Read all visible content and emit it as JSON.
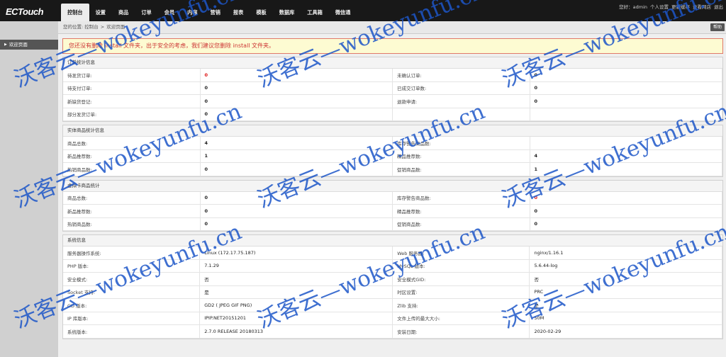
{
  "app": {
    "logo": "ECTouch"
  },
  "nav": [
    "控制台",
    "设置",
    "商品",
    "订单",
    "会员",
    "内容",
    "营销",
    "报表",
    "模板",
    "数据库",
    "工具箱",
    "微信通"
  ],
  "top_links": [
    "您好：admin",
    "个人设置",
    "更新缓存",
    "查看网店",
    "退出"
  ],
  "sidebar": {
    "items": [
      {
        "label": "欢迎页面"
      }
    ]
  },
  "breadcrumb": {
    "prefix": "您的位置:",
    "path": [
      "控制台",
      "欢迎页面"
    ],
    "help": "帮助"
  },
  "warning": "您还没有删除 install 文件夹，出于安全的考虑，我们建议您删除 install 文件夹。",
  "panels": [
    {
      "title": "订单统计信息",
      "rows": [
        [
          [
            "待发货订单:",
            "0",
            "red"
          ],
          [
            "未确认订单:",
            "0",
            ""
          ]
        ],
        [
          [
            "待支付订单:",
            "0",
            ""
          ],
          [
            "已成交订单数:",
            "0",
            ""
          ]
        ],
        [
          [
            "新缺货登记:",
            "0",
            ""
          ],
          [
            "退款申请:",
            "0",
            ""
          ]
        ],
        [
          [
            "部分发货订单:",
            "0",
            ""
          ],
          [
            "",
            "",
            " "
          ]
        ]
      ]
    },
    {
      "title": "实体商品统计信息",
      "rows": [
        [
          [
            "商品总数:",
            "4",
            ""
          ],
          [
            "库存警告商品数:",
            "",
            ""
          ]
        ],
        [
          [
            "新品推荐数:",
            "1",
            ""
          ],
          [
            "精品推荐数:",
            "4",
            ""
          ]
        ],
        [
          [
            "热销商品数:",
            "0",
            ""
          ],
          [
            "促销商品数:",
            "1",
            ""
          ]
        ]
      ]
    },
    {
      "title": "虚拟卡商品统计",
      "rows": [
        [
          [
            "商品总数:",
            "0",
            ""
          ],
          [
            "库存警告商品数:",
            "0",
            "red"
          ]
        ],
        [
          [
            "新品推荐数:",
            "0",
            ""
          ],
          [
            "精品推荐数:",
            "0",
            ""
          ]
        ],
        [
          [
            "热销商品数:",
            "0",
            ""
          ],
          [
            "促销商品数:",
            "0",
            ""
          ]
        ]
      ]
    },
    {
      "title": "系统信息",
      "rows": [
        [
          [
            "服务器操作系统:",
            "Linux (172.17.75.187)",
            "norm"
          ],
          [
            "Web 服务器:",
            "nginx/1.16.1",
            "norm"
          ]
        ],
        [
          [
            "PHP 版本:",
            "7.1.29",
            "norm"
          ],
          [
            "MySQL 版本:",
            "5.6.44-log",
            "norm"
          ]
        ],
        [
          [
            "安全模式:",
            "否",
            "norm"
          ],
          [
            "安全模式GID:",
            "否",
            "norm"
          ]
        ],
        [
          [
            "Socket 支持:",
            "是",
            "norm"
          ],
          [
            "时区设置:",
            "PRC",
            "norm"
          ]
        ],
        [
          [
            "GD 版本:",
            "GD2 ( JPEG GIF PNG)",
            "norm"
          ],
          [
            "Zlib 支持:",
            "是",
            "norm"
          ]
        ],
        [
          [
            "IP 库版本:",
            "IPIP.NET20151201",
            "norm"
          ],
          [
            "文件上传的最大大小:",
            "50M",
            "norm"
          ]
        ],
        [
          [
            "系统版本:",
            "2.7.0 RELEASE 20180313",
            "norm"
          ],
          [
            "安装日期:",
            "2020-02-29",
            "norm"
          ]
        ]
      ]
    }
  ],
  "watermark": "沃客云—wokeyunfu.cn",
  "colors": {
    "topbar": "#181818",
    "warning_bg": "#fdfbd2",
    "warning_text": "#cc3333",
    "watermark": "#1d56c8"
  }
}
